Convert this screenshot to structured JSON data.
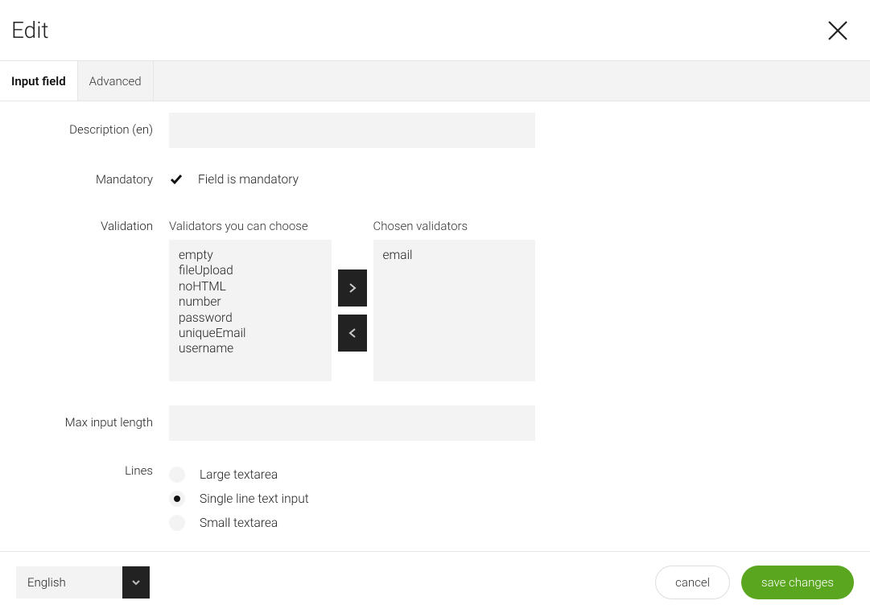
{
  "header": {
    "title": "Edit"
  },
  "tabs": [
    {
      "label": "Input field",
      "active": true
    },
    {
      "label": "Advanced",
      "active": false
    }
  ],
  "form": {
    "description": {
      "label": "Description (en)",
      "value": ""
    },
    "mandatory": {
      "label": "Mandatory",
      "checkbox_label": "Field is mandatory",
      "checked": true
    },
    "validation": {
      "label": "Validation",
      "available_title": "Validators you can choose",
      "chosen_title": "Chosen validators",
      "available": [
        "empty",
        "fileUpload",
        "noHTML",
        "number",
        "password",
        "uniqueEmail",
        "username"
      ],
      "chosen": [
        "email"
      ]
    },
    "max_length": {
      "label": "Max input length",
      "value": ""
    },
    "lines": {
      "label": "Lines",
      "options": [
        {
          "label": "Large textarea",
          "selected": false
        },
        {
          "label": "Single line text input",
          "selected": true
        },
        {
          "label": "Small textarea",
          "selected": false
        }
      ]
    }
  },
  "footer": {
    "language": "English",
    "cancel": "cancel",
    "save": "save changes"
  }
}
